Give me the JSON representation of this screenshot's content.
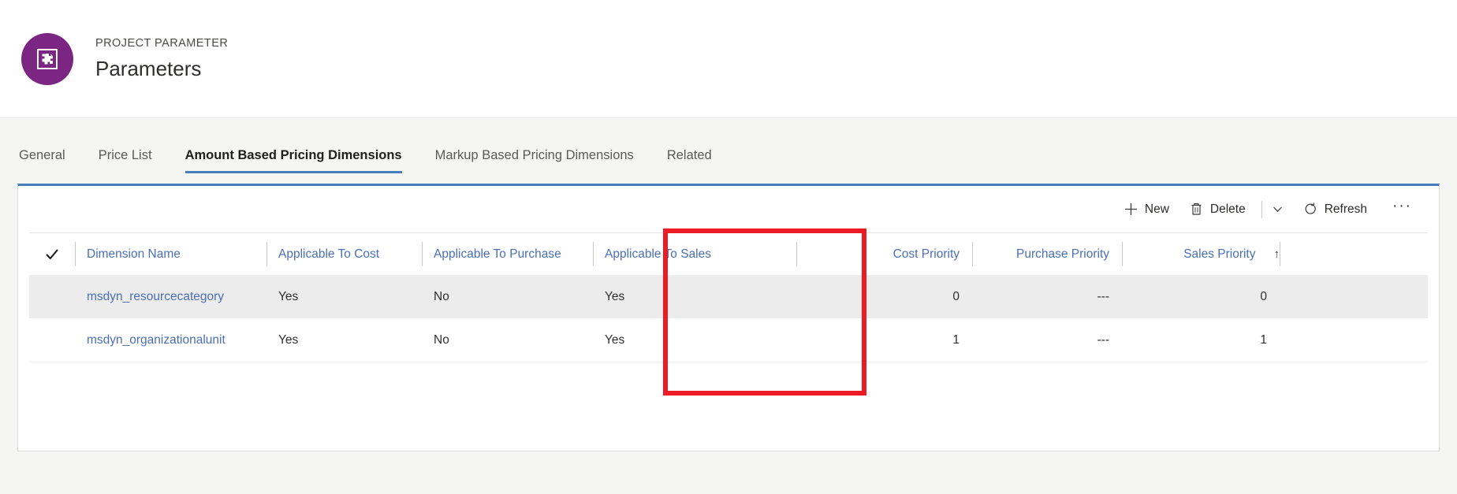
{
  "header": {
    "entity_type": "PROJECT PARAMETER",
    "title": "Parameters",
    "avatar_icon": "parameters-entity-icon",
    "avatar_color": "#7b2682"
  },
  "tabs": [
    {
      "label": "General",
      "active": false
    },
    {
      "label": "Price List",
      "active": false
    },
    {
      "label": "Amount Based Pricing Dimensions",
      "active": true
    },
    {
      "label": "Markup Based Pricing Dimensions",
      "active": false
    },
    {
      "label": "Related",
      "active": false
    }
  ],
  "toolbar": {
    "new_label": "New",
    "delete_label": "Delete",
    "refresh_label": "Refresh",
    "chevron_icon": "chevron-down-icon",
    "more_icon": "more-commands-icon",
    "more_label": "···"
  },
  "grid": {
    "select_all_icon": "checkmark-icon",
    "columns": [
      {
        "label": "Dimension Name",
        "align": "left",
        "sorted": false
      },
      {
        "label": "Applicable To Cost",
        "align": "left",
        "sorted": false
      },
      {
        "label": "Applicable To Purchase",
        "align": "left",
        "sorted": false
      },
      {
        "label": "Applicable To Sales",
        "align": "left",
        "sorted": false
      },
      {
        "label": "Cost Priority",
        "align": "right",
        "sorted": false
      },
      {
        "label": "Purchase Priority",
        "align": "right",
        "sorted": false
      },
      {
        "label": "Sales Priority",
        "align": "right",
        "sorted": true,
        "sort_arrow": "↑"
      }
    ],
    "rows": [
      {
        "dimension_name": "msdyn_resourcecategory",
        "applicable_to_cost": "Yes",
        "applicable_to_purchase": "No",
        "applicable_to_sales": "Yes",
        "cost_priority": "0",
        "purchase_priority": "---",
        "sales_priority": "0"
      },
      {
        "dimension_name": "msdyn_organizationalunit",
        "applicable_to_cost": "Yes",
        "applicable_to_purchase": "No",
        "applicable_to_sales": "Yes",
        "cost_priority": "1",
        "purchase_priority": "---",
        "sales_priority": "1"
      }
    ]
  },
  "annotation": {
    "color": "#ec1c24",
    "target_column": "Applicable To Sales"
  }
}
